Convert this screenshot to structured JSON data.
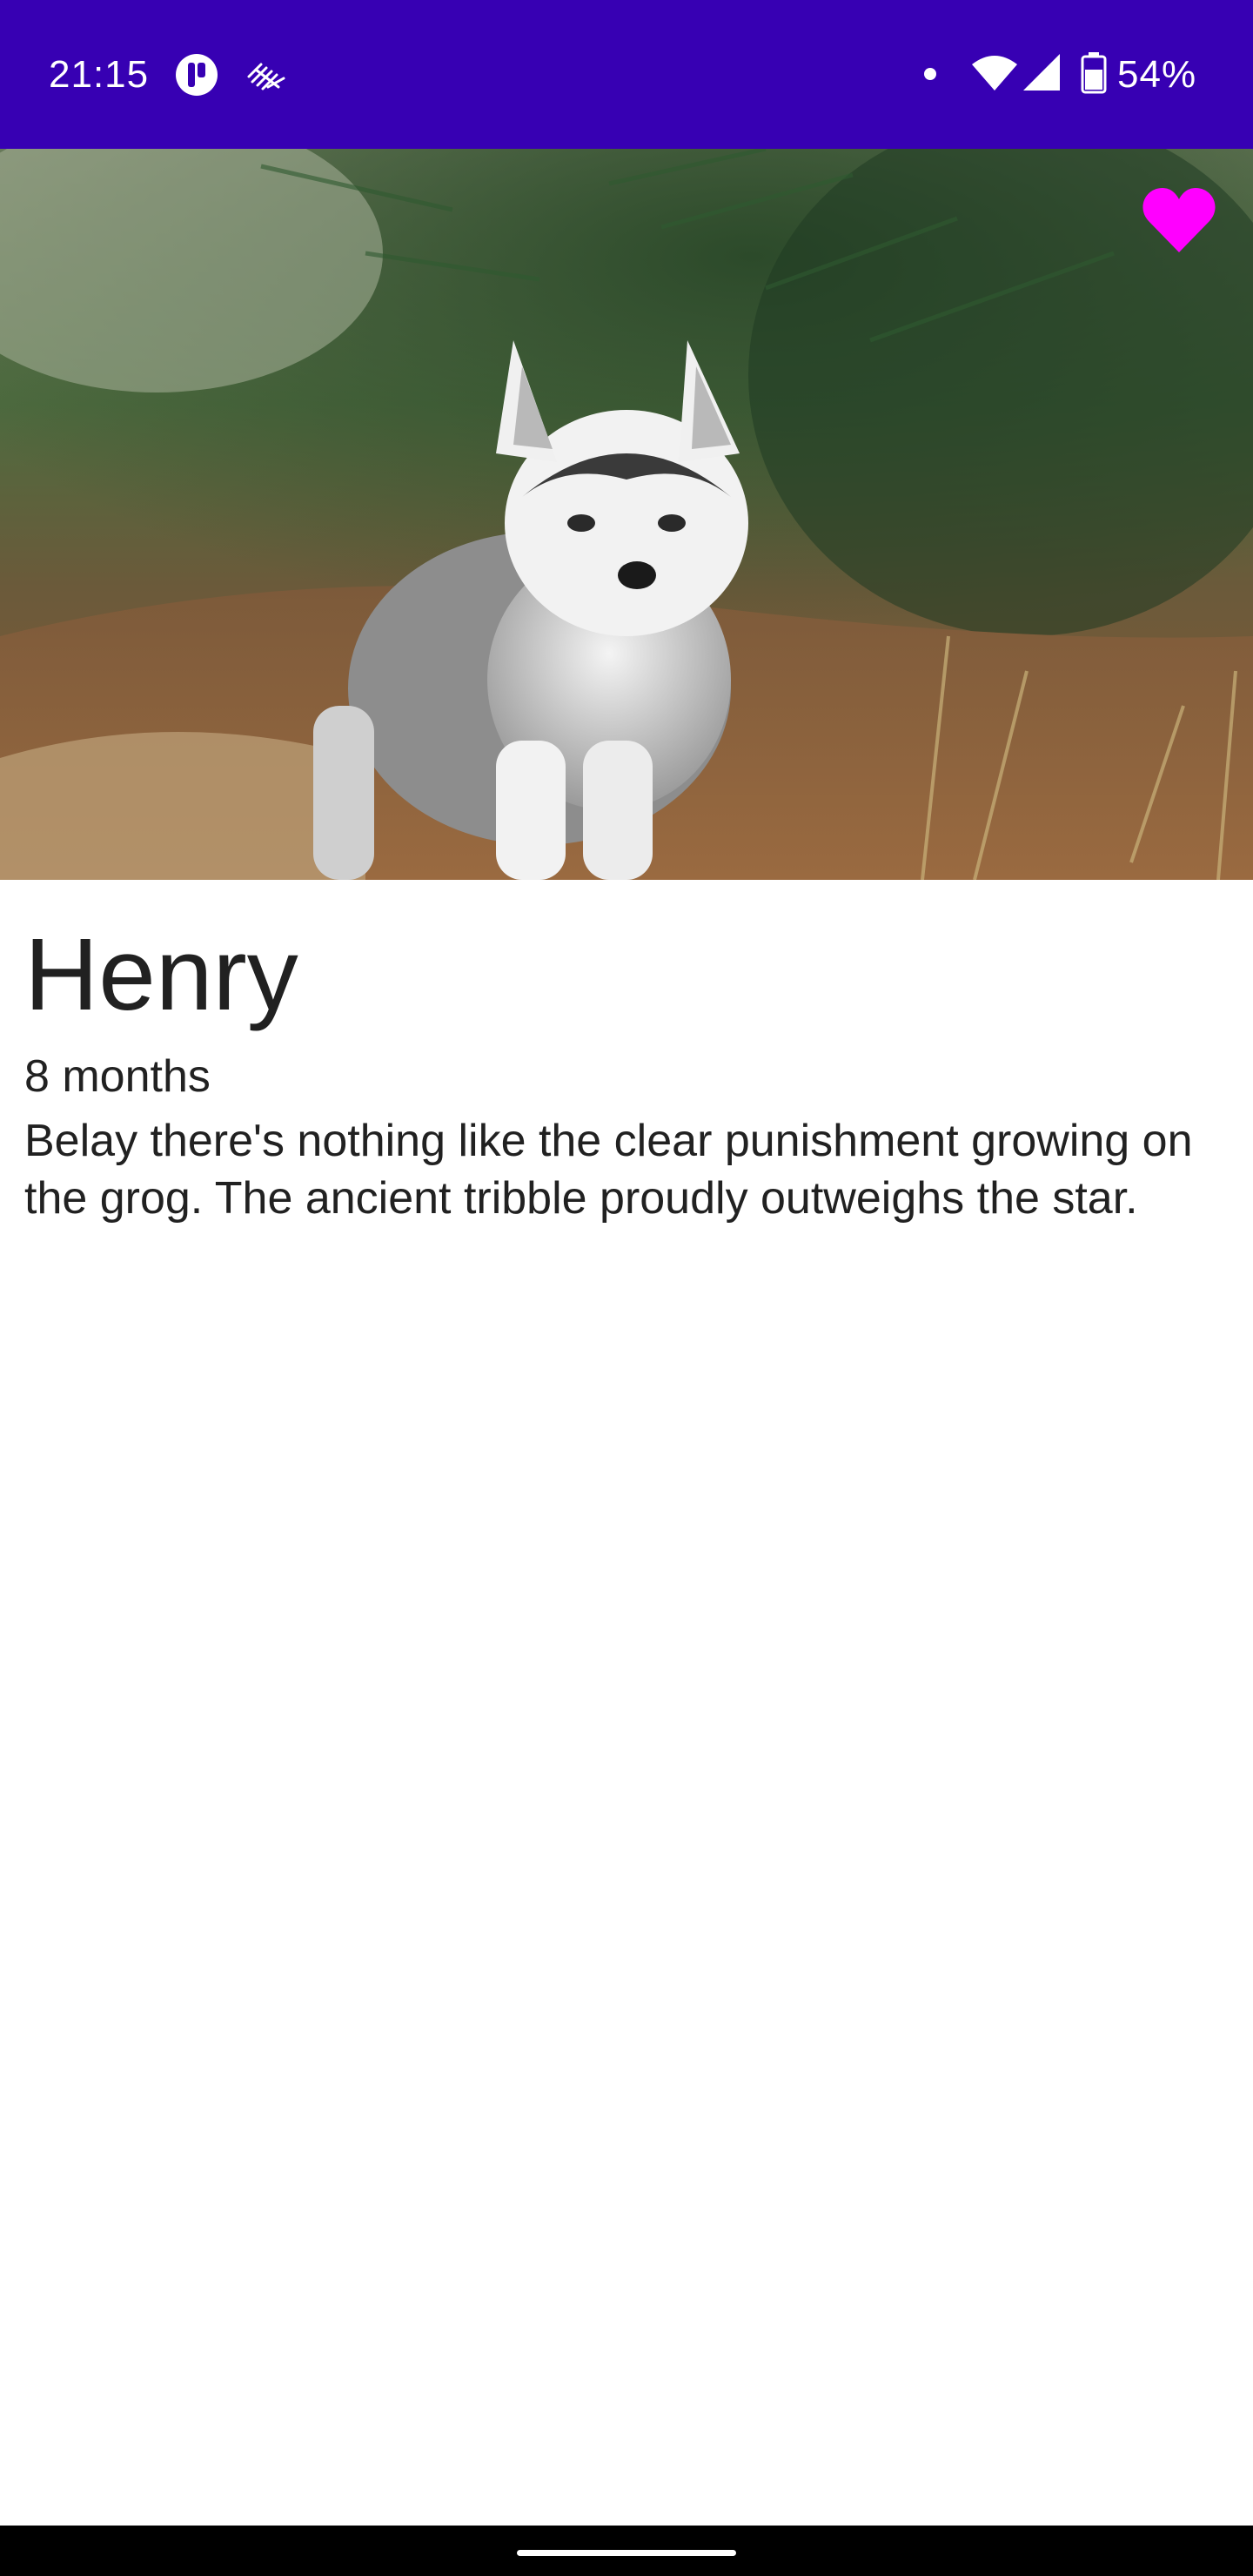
{
  "status_bar": {
    "time": "21:15",
    "battery_text": "54%",
    "background_color": "#3700b3",
    "icons": [
      "app-notification-icon",
      "app-notification-icon-2",
      "notification-dot-icon",
      "wifi-icon",
      "cell-signal-icon",
      "battery-icon"
    ]
  },
  "hero_image": {
    "alt": "Siberian husky puppy standing under a pine tree",
    "favorite_icon": "heart-icon",
    "favorite_color": "#ff00ff"
  },
  "pet": {
    "name": "Henry",
    "age": "8 months",
    "description": "Belay there's nothing like the clear punishment growing on the grog. The ancient tribble proudly outweighs the star."
  },
  "nav_bar": {
    "handle_icon": "gesture-handle-icon"
  }
}
